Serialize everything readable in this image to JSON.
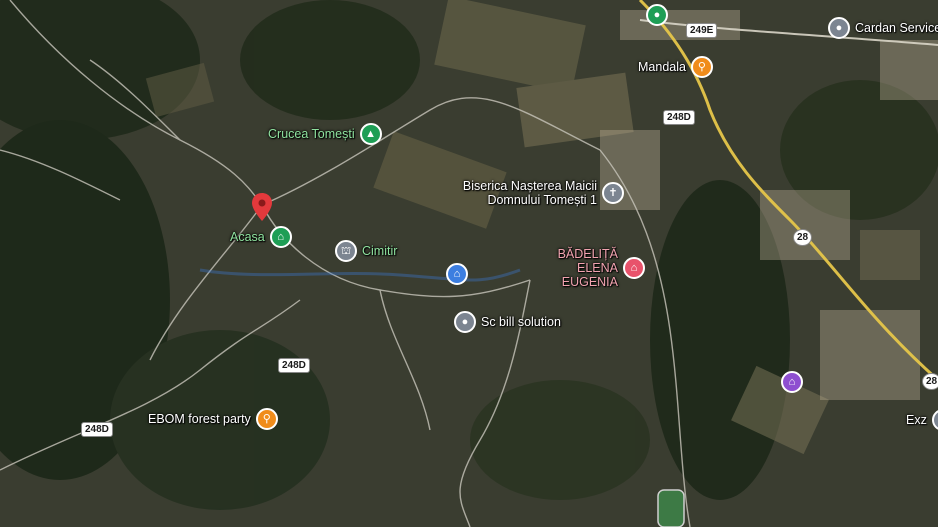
{
  "map": {
    "view": "satellite"
  },
  "colors": {
    "green": "#1e9e55",
    "orange": "#f08c1b",
    "gray": "#7c8591",
    "blue": "#3c7ee0",
    "red_pin": "#e3393c",
    "rose": "#e8526b",
    "purple": "#8e4fd0"
  },
  "places": [
    {
      "name": "Cardan Service",
      "icon": "place-pin-icon",
      "color": "gray",
      "label_color": "#ffffff"
    },
    {
      "name": "Mandala",
      "icon": "fork-knife-icon",
      "color": "orange",
      "label_color": "#ffffff"
    },
    {
      "name": "Crucea Tomești",
      "icon": "tree-icon",
      "color": "green",
      "label_color": "#8fe39f"
    },
    {
      "name": "Biserica Nașterea Maicii Domnului Tomești 1",
      "icon": "cross-icon",
      "color": "gray",
      "label_color": "#ffffff"
    },
    {
      "name": "Acasa",
      "icon": "picnic-icon",
      "color": "green",
      "label_color": "#8fe39f"
    },
    {
      "name": "Cimitir",
      "icon": "cemetery-icon",
      "color": "gray",
      "label_color": "#8fe39f"
    },
    {
      "name": "BĂDELIȚĂ ELENA EUGENIA",
      "icon": "clinic-icon",
      "color": "rose",
      "label_color": "#f2a3b0"
    },
    {
      "name": "Sc bill solution",
      "icon": "place-pin-icon",
      "color": "gray",
      "label_color": "#ffffff"
    },
    {
      "name": "EBOM forest party",
      "icon": "fork-knife-icon",
      "color": "orange",
      "label_color": "#ffffff"
    },
    {
      "name": "Exz",
      "icon": "place-pin-icon",
      "color": "gray",
      "label_color": "#ffffff"
    },
    {
      "name": "",
      "icon": "landmark-icon",
      "color": "purple"
    },
    {
      "name": "",
      "icon": "mosque-icon",
      "color": "blue"
    },
    {
      "name": "",
      "icon": "green-place-icon",
      "color": "green"
    },
    {
      "name": "",
      "icon": "red-location-pin-icon",
      "color": "red_pin"
    }
  ],
  "roads": [
    "249E",
    "248D",
    "248D",
    "248D",
    "28",
    "28"
  ]
}
